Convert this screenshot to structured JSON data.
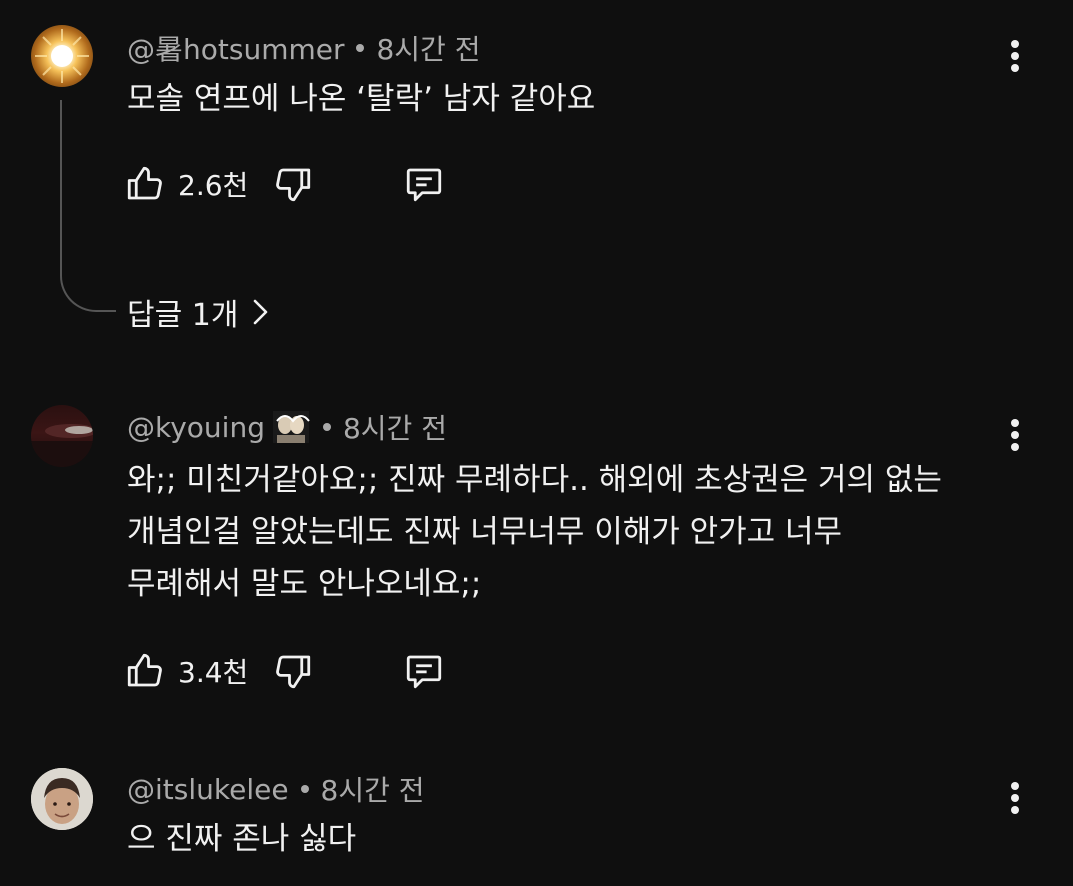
{
  "comments": [
    {
      "handle": "@暑hotsummer",
      "time": "8시간 전",
      "lines": [
        "모솔 연프에 나온 ‘탈락’ 남자 같아요"
      ],
      "likes": "2.6천",
      "replies_label": "답글 1개"
    },
    {
      "handle": "@kyouing",
      "time": "8시간 전",
      "lines": [
        "와;; 미친거같아요;; 진짜 무례하다.. 해외에 초상권은 거의 없는",
        "개념인걸 알았는데도 진짜 너무너무 이해가 안가고 너무",
        "무례해서 말도 안나오네요;;"
      ],
      "likes": "3.4천"
    },
    {
      "handle": "@itslukelee",
      "time": "8시간 전",
      "lines": [
        "으 진짜 존나 싫다"
      ]
    }
  ],
  "icons": {
    "like": "thumbs-up-icon",
    "dislike": "thumbs-down-icon",
    "reply": "comment-icon",
    "more": "more-vertical-icon",
    "chevron": "chevron-right-icon"
  },
  "colors": {
    "background": "#0f0f0f",
    "text": "#f1f1f1",
    "meta": "#aaaaaa",
    "thread_line": "#555555"
  }
}
